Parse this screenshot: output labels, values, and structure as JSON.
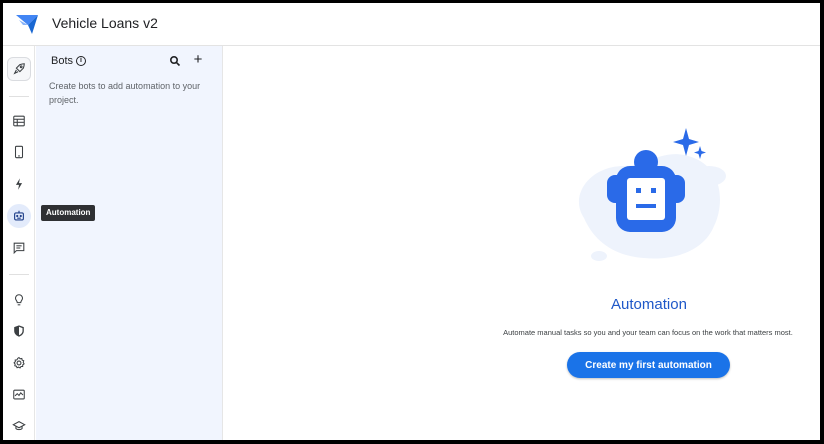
{
  "header": {
    "app_title": "Vehicle Loans v2",
    "logo_icon": "appsheet-logo-icon"
  },
  "rail": {
    "items": [
      {
        "name": "rocket-icon",
        "label": "Home"
      },
      {
        "name": "table-icon",
        "label": "Data"
      },
      {
        "name": "phone-icon",
        "label": "App"
      },
      {
        "name": "bolt-icon",
        "label": "Actions"
      },
      {
        "name": "robot-icon",
        "label": "Automation",
        "active": true
      },
      {
        "name": "chat-icon",
        "label": "Chat"
      },
      {
        "name": "lightbulb-icon",
        "label": "Intelligence"
      },
      {
        "name": "shield-icon",
        "label": "Security"
      },
      {
        "name": "gear-icon",
        "label": "Settings"
      },
      {
        "name": "monitor-icon",
        "label": "Manage"
      },
      {
        "name": "graduation-cap-icon",
        "label": "Learn"
      }
    ],
    "tooltip": "Automation"
  },
  "panel": {
    "title": "Bots",
    "description": "Create bots to add automation to your project."
  },
  "main": {
    "title": "Automation",
    "description": "Automate manual tasks so you and your team can focus on the work that matters most.",
    "cta_label": "Create my first automation"
  },
  "colors": {
    "accent": "#1a73e8",
    "title_blue": "#1f58c8",
    "panel_bg": "#f1f5fe",
    "robot_blue": "#2a6ae8"
  }
}
